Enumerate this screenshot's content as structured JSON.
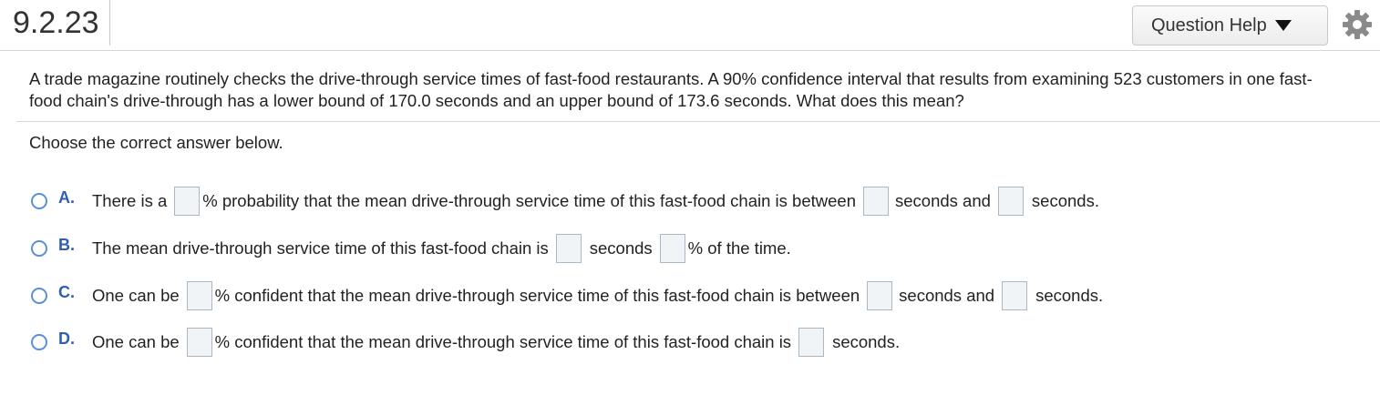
{
  "header": {
    "question_number": "9.2.23",
    "help_button_label": "Question Help"
  },
  "question": {
    "text": "A trade magazine routinely checks the drive-through service times of fast-food restaurants. A 90% confidence interval that results from examining 523 customers in one fast-food chain's drive-through has a lower bound of 170.0 seconds and an upper bound of 173.6 seconds. What does this mean?",
    "prompt": "Choose the correct answer below."
  },
  "options": [
    {
      "letter": "A.",
      "parts": [
        "There is a",
        "% probability that the mean drive-through service time of this fast-food chain is between",
        "seconds and",
        "seconds."
      ]
    },
    {
      "letter": "B.",
      "parts": [
        "The mean drive-through service time of this fast-food chain is",
        "seconds",
        "% of the time."
      ]
    },
    {
      "letter": "C.",
      "parts": [
        "One can be",
        "% confident that the mean drive-through service time of this fast-food chain is between",
        "seconds and",
        "seconds."
      ]
    },
    {
      "letter": "D.",
      "parts": [
        "One can be",
        "% confident that the mean drive-through service time of this fast-food chain is",
        "seconds."
      ]
    }
  ],
  "icons": {
    "help_caret": "caret-down-icon",
    "settings": "gear-icon"
  }
}
